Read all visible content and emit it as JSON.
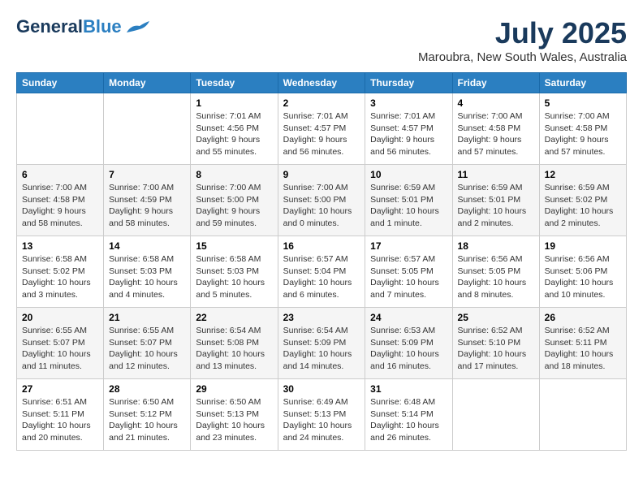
{
  "logo": {
    "general": "General",
    "blue": "Blue"
  },
  "title": {
    "month_year": "July 2025",
    "location": "Maroubra, New South Wales, Australia"
  },
  "weekdays": [
    "Sunday",
    "Monday",
    "Tuesday",
    "Wednesday",
    "Thursday",
    "Friday",
    "Saturday"
  ],
  "weeks": [
    [
      {
        "day": "",
        "info": ""
      },
      {
        "day": "",
        "info": ""
      },
      {
        "day": "1",
        "info": "Sunrise: 7:01 AM\nSunset: 4:56 PM\nDaylight: 9 hours and 55 minutes."
      },
      {
        "day": "2",
        "info": "Sunrise: 7:01 AM\nSunset: 4:57 PM\nDaylight: 9 hours and 56 minutes."
      },
      {
        "day": "3",
        "info": "Sunrise: 7:01 AM\nSunset: 4:57 PM\nDaylight: 9 hours and 56 minutes."
      },
      {
        "day": "4",
        "info": "Sunrise: 7:00 AM\nSunset: 4:58 PM\nDaylight: 9 hours and 57 minutes."
      },
      {
        "day": "5",
        "info": "Sunrise: 7:00 AM\nSunset: 4:58 PM\nDaylight: 9 hours and 57 minutes."
      }
    ],
    [
      {
        "day": "6",
        "info": "Sunrise: 7:00 AM\nSunset: 4:58 PM\nDaylight: 9 hours and 58 minutes."
      },
      {
        "day": "7",
        "info": "Sunrise: 7:00 AM\nSunset: 4:59 PM\nDaylight: 9 hours and 58 minutes."
      },
      {
        "day": "8",
        "info": "Sunrise: 7:00 AM\nSunset: 5:00 PM\nDaylight: 9 hours and 59 minutes."
      },
      {
        "day": "9",
        "info": "Sunrise: 7:00 AM\nSunset: 5:00 PM\nDaylight: 10 hours and 0 minutes."
      },
      {
        "day": "10",
        "info": "Sunrise: 6:59 AM\nSunset: 5:01 PM\nDaylight: 10 hours and 1 minute."
      },
      {
        "day": "11",
        "info": "Sunrise: 6:59 AM\nSunset: 5:01 PM\nDaylight: 10 hours and 2 minutes."
      },
      {
        "day": "12",
        "info": "Sunrise: 6:59 AM\nSunset: 5:02 PM\nDaylight: 10 hours and 2 minutes."
      }
    ],
    [
      {
        "day": "13",
        "info": "Sunrise: 6:58 AM\nSunset: 5:02 PM\nDaylight: 10 hours and 3 minutes."
      },
      {
        "day": "14",
        "info": "Sunrise: 6:58 AM\nSunset: 5:03 PM\nDaylight: 10 hours and 4 minutes."
      },
      {
        "day": "15",
        "info": "Sunrise: 6:58 AM\nSunset: 5:03 PM\nDaylight: 10 hours and 5 minutes."
      },
      {
        "day": "16",
        "info": "Sunrise: 6:57 AM\nSunset: 5:04 PM\nDaylight: 10 hours and 6 minutes."
      },
      {
        "day": "17",
        "info": "Sunrise: 6:57 AM\nSunset: 5:05 PM\nDaylight: 10 hours and 7 minutes."
      },
      {
        "day": "18",
        "info": "Sunrise: 6:56 AM\nSunset: 5:05 PM\nDaylight: 10 hours and 8 minutes."
      },
      {
        "day": "19",
        "info": "Sunrise: 6:56 AM\nSunset: 5:06 PM\nDaylight: 10 hours and 10 minutes."
      }
    ],
    [
      {
        "day": "20",
        "info": "Sunrise: 6:55 AM\nSunset: 5:07 PM\nDaylight: 10 hours and 11 minutes."
      },
      {
        "day": "21",
        "info": "Sunrise: 6:55 AM\nSunset: 5:07 PM\nDaylight: 10 hours and 12 minutes."
      },
      {
        "day": "22",
        "info": "Sunrise: 6:54 AM\nSunset: 5:08 PM\nDaylight: 10 hours and 13 minutes."
      },
      {
        "day": "23",
        "info": "Sunrise: 6:54 AM\nSunset: 5:09 PM\nDaylight: 10 hours and 14 minutes."
      },
      {
        "day": "24",
        "info": "Sunrise: 6:53 AM\nSunset: 5:09 PM\nDaylight: 10 hours and 16 minutes."
      },
      {
        "day": "25",
        "info": "Sunrise: 6:52 AM\nSunset: 5:10 PM\nDaylight: 10 hours and 17 minutes."
      },
      {
        "day": "26",
        "info": "Sunrise: 6:52 AM\nSunset: 5:11 PM\nDaylight: 10 hours and 18 minutes."
      }
    ],
    [
      {
        "day": "27",
        "info": "Sunrise: 6:51 AM\nSunset: 5:11 PM\nDaylight: 10 hours and 20 minutes."
      },
      {
        "day": "28",
        "info": "Sunrise: 6:50 AM\nSunset: 5:12 PM\nDaylight: 10 hours and 21 minutes."
      },
      {
        "day": "29",
        "info": "Sunrise: 6:50 AM\nSunset: 5:13 PM\nDaylight: 10 hours and 23 minutes."
      },
      {
        "day": "30",
        "info": "Sunrise: 6:49 AM\nSunset: 5:13 PM\nDaylight: 10 hours and 24 minutes."
      },
      {
        "day": "31",
        "info": "Sunrise: 6:48 AM\nSunset: 5:14 PM\nDaylight: 10 hours and 26 minutes."
      },
      {
        "day": "",
        "info": ""
      },
      {
        "day": "",
        "info": ""
      }
    ]
  ]
}
